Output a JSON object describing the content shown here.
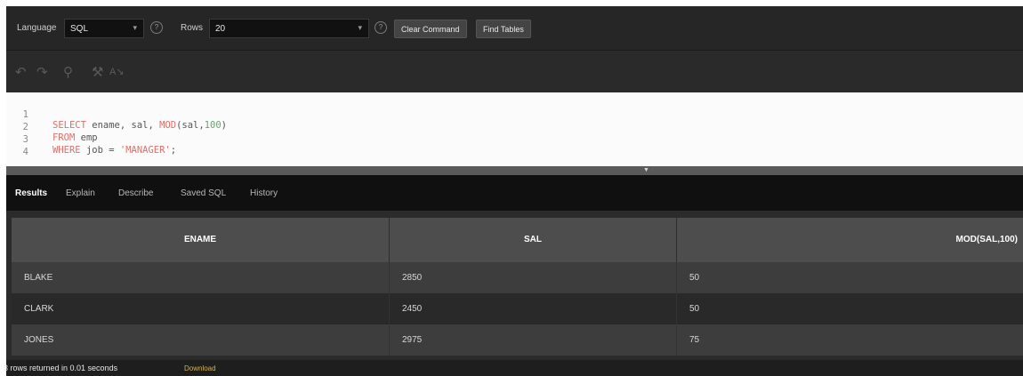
{
  "toolbar": {
    "language_label": "Language",
    "language_value": "SQL",
    "rows_label": "Rows",
    "rows_value": "20",
    "clear_command": "Clear Command",
    "find_tables": "Find Tables"
  },
  "iconbar": {
    "icons": [
      "undo-icon",
      "redo-icon",
      "search-icon",
      "wrench-icon",
      "format-icon"
    ]
  },
  "editor": {
    "line_numbers": [
      "1",
      "2",
      "3",
      "4"
    ],
    "lines": [
      {
        "kw": "SELECT",
        "a": " ename, sal, ",
        "fn": "MOD",
        "b": "(sal,",
        "num": "100",
        "c": ")"
      },
      {
        "kw": "FROM",
        "a": " emp"
      },
      {
        "kw": "WHERE",
        "a": " job = ",
        "str": "'MANAGER'",
        "c": ";"
      }
    ]
  },
  "tabs": [
    "Results",
    "Explain",
    "Describe",
    "Saved SQL",
    "History"
  ],
  "results": {
    "columns": [
      "ENAME",
      "SAL",
      "MOD(SAL,100)"
    ],
    "rows": [
      [
        "BLAKE",
        "2850",
        "50"
      ],
      [
        "CLARK",
        "2450",
        "50"
      ],
      [
        "JONES",
        "2975",
        "75"
      ]
    ]
  },
  "footer": {
    "status": "3 rows returned in 0.01 seconds",
    "download": "Download"
  },
  "colors": {
    "keyword": "#d9716a",
    "number": "#5fa86a",
    "download_link": "#d4b24c",
    "header_bg": "#4d4d4d"
  }
}
